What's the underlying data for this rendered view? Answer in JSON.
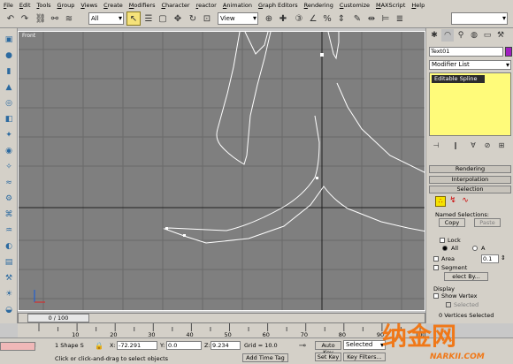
{
  "menu": [
    "File",
    "Edit",
    "Tools",
    "Group",
    "Views",
    "Create",
    "Modifiers",
    "Character",
    "reactor",
    "Animation",
    "Graph Editors",
    "Rendering",
    "Customize",
    "MAXScript",
    "Help"
  ],
  "toolbar": {
    "selection_filter": "All",
    "ref_coord": "View",
    "named_selection": ""
  },
  "viewport": {
    "label": "Front"
  },
  "panel": {
    "object_name": "Text01",
    "object_color": "#a020c0",
    "modifier_list": "Modifier List",
    "stack_item": "Editable Spline",
    "rollouts": {
      "rendering": "Rendering",
      "interpolation": "Interpolation",
      "selection": "Selection"
    },
    "named_selections": "Named Selections:",
    "copy": "Copy",
    "paste": "Paste",
    "lock": "Lock",
    "all_radio": "All",
    "a_radio": "A",
    "area": "Area",
    "area_value": "0.1",
    "segment": "Segment",
    "select_by": "elect By...",
    "display_group": "Display",
    "show_vertex": "Show Vertex",
    "selected": "Selected",
    "footer": "0 Vertices Selected"
  },
  "timeslider": {
    "label": "0 / 100"
  },
  "ruler": [
    10,
    20,
    30,
    40,
    50,
    60,
    70,
    80,
    90,
    100
  ],
  "status": {
    "shape_selected": "1 Shape S",
    "x_label": "X:",
    "x_value": "-72.291",
    "y_label": "Y:",
    "y_value": "0.0",
    "z_label": "Z:",
    "z_value": "9.234",
    "grid": "Grid = 10.0",
    "auto_key": "Auto Key",
    "selected_dropdown": "Selected",
    "set_key": "Set Key",
    "key_filters": "Key Filters...",
    "prompt": "Click or click-and-drag to select objects",
    "add_time_tag": "Add Time Tag"
  },
  "watermark": {
    "cn": "纳金网",
    "url": "NARKII.COM"
  },
  "colors": {
    "ui_gray": "#d4d0c8",
    "viewport": "#7f7f7f",
    "accent_yellow": "#f5e27a",
    "watermark": "#f07818"
  }
}
